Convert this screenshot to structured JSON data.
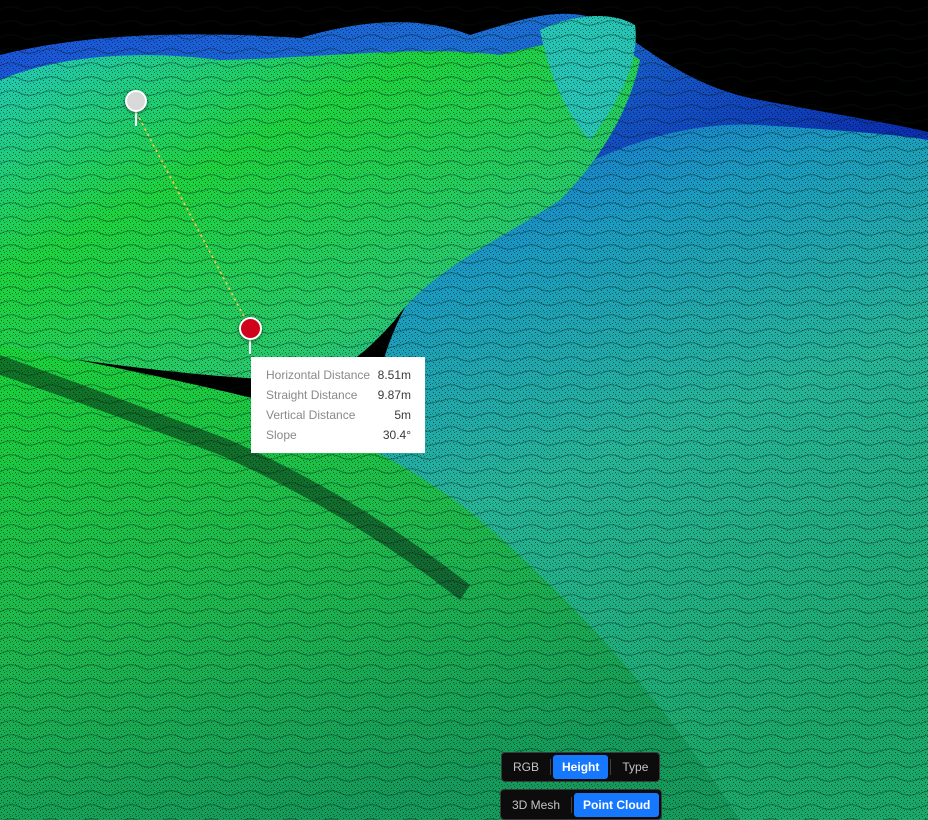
{
  "viewer": {
    "scene_icon": "point-cloud-terrain"
  },
  "measurement": {
    "start_marker_color": "#d8d8d8",
    "end_marker_color": "#d0021b",
    "rows": [
      {
        "label": "Horizontal Distance",
        "value": "8.51m"
      },
      {
        "label": "Straight Distance",
        "value": "9.87m"
      },
      {
        "label": "Vertical Distance",
        "value": "5m"
      },
      {
        "label": "Slope",
        "value": "30.4°"
      }
    ]
  },
  "color_mode": {
    "options": [
      "RGB",
      "Height",
      "Type"
    ],
    "selected": "Height"
  },
  "render_mode": {
    "options": [
      "3D Mesh",
      "Point Cloud"
    ],
    "selected": "Point Cloud"
  },
  "colors": {
    "accent": "#1677ff",
    "terrain_low": "#00b838",
    "terrain_mid": "#1fa8a8",
    "terrain_high": "#0a3fc0"
  }
}
